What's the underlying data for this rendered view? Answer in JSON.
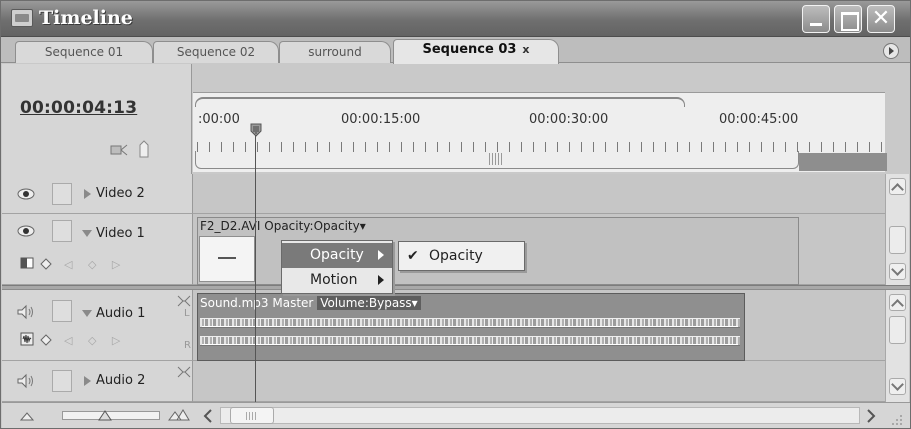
{
  "window": {
    "title": "Timeline"
  },
  "tabs": [
    {
      "label": "Sequence 01",
      "active": false
    },
    {
      "label": "Sequence 02",
      "active": false
    },
    {
      "label": "surround",
      "active": false
    },
    {
      "label": "Sequence 03",
      "active": true,
      "close": "x"
    }
  ],
  "timeline": {
    "timecode": "00:00:04:13",
    "ruler_labels": [
      ":00:00",
      "00:00:15:00",
      "00:00:30:00",
      "00:00:45:00"
    ]
  },
  "tracks": {
    "video2": {
      "name": "Video 2",
      "expanded": false
    },
    "video1": {
      "name": "Video 1",
      "expanded": true,
      "clip_name": "F2_D2.AVI",
      "clip_effect": "Opacity:Opacity"
    },
    "audio1": {
      "name": "Audio 1",
      "expanded": true,
      "clip_name": "Sound.mp3",
      "channel": "Master",
      "volume": "Volume:Bypass",
      "lr_left": "L",
      "lr_right": "R"
    },
    "audio2": {
      "name": "Audio 2",
      "expanded": false
    }
  },
  "context_menu": {
    "items": [
      {
        "label": "Opacity",
        "highlighted": true
      },
      {
        "label": "Motion",
        "highlighted": false
      }
    ],
    "submenu": {
      "label": "Opacity",
      "check": "✔"
    }
  },
  "dropdown_arrow": "▾",
  "icons": {
    "eye": "eye-icon",
    "speaker": "speaker-icon",
    "snap": "snap-icon",
    "marker": "marker-icon"
  }
}
